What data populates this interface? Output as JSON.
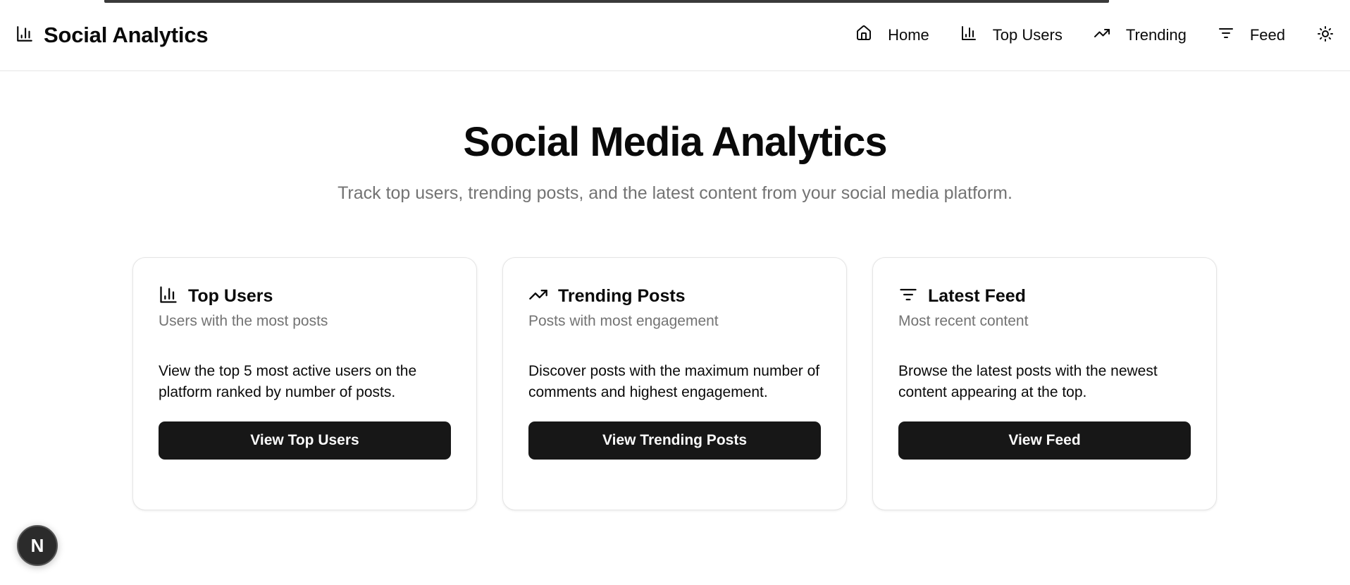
{
  "header": {
    "brand_icon": "bar-chart-icon",
    "title": "Social Analytics",
    "nav": [
      {
        "label": "Home",
        "icon": "home-icon"
      },
      {
        "label": "Top Users",
        "icon": "bar-chart-icon"
      },
      {
        "label": "Trending",
        "icon": "trending-up-icon"
      },
      {
        "label": "Feed",
        "icon": "filter-icon"
      }
    ],
    "theme_toggle_icon": "sun-icon"
  },
  "hero": {
    "title": "Social Media Analytics",
    "subtitle": "Track top users, trending posts, and the latest content from your social media platform."
  },
  "cards": [
    {
      "icon": "bar-chart-icon",
      "title": "Top Users",
      "subtitle": "Users with the most posts",
      "description": "View the top 5 most active users on the platform ranked by number of posts.",
      "button": "View Top Users"
    },
    {
      "icon": "trending-up-icon",
      "title": "Trending Posts",
      "subtitle": "Posts with most engagement",
      "description": "Discover posts with the maximum number of comments and highest engagement.",
      "button": "View Trending Posts"
    },
    {
      "icon": "filter-icon",
      "title": "Latest Feed",
      "subtitle": "Most recent content",
      "description": "Browse the latest posts with the newest content appearing at the top.",
      "button": "View Feed"
    }
  ],
  "dev_badge": {
    "label": "N"
  },
  "colors": {
    "primary_button": "#171717",
    "muted_text": "#737373",
    "border": "#e5e5e5"
  }
}
